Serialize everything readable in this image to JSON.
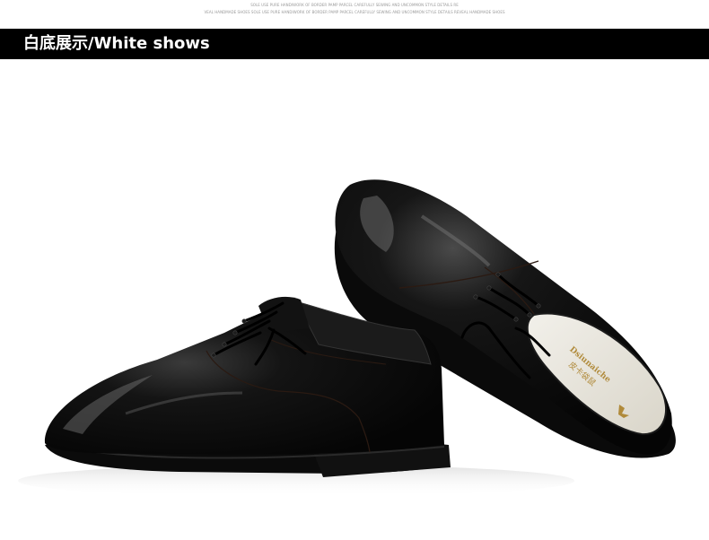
{
  "header": {
    "tiny_line_1": "SOLE USE PURE HANDIWORK OF BORDER PAMP PARCEL CAREFULLY SEWING AND UNCOMMON STYLE DETAILS RE",
    "tiny_line_2": "VEAL HANDMADE SHOES SOLE USE PURE HANDIWORK OF BORDER PAMP PARCEL CAREFULLY SEWING AND UNCOMMON STYLE DETAILS REVEAL HANDMADE SHOES"
  },
  "banner": {
    "title": "白底展示/White shows",
    "background": "#000000",
    "text_color": "#ffffff"
  },
  "photo": {
    "insole_brand_latin": "Dsiunaiche",
    "insole_brand_cn": "皮卡袋鼠",
    "shoe_color": "#0c0c0c",
    "insole_gold": "#b08a3a"
  }
}
